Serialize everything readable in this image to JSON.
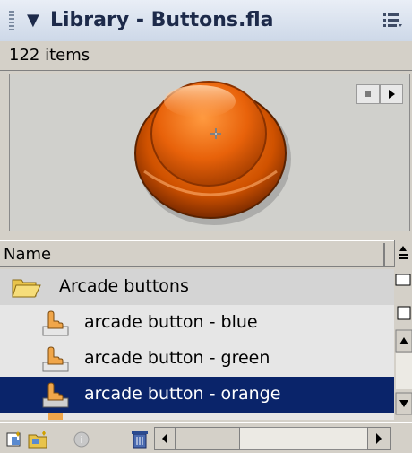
{
  "panel": {
    "title": "Library - Buttons.fla",
    "item_count": "122 items"
  },
  "preview": {
    "symbol": "arcade button - orange",
    "colors": {
      "face": "#e8620a",
      "rim": "#b84400",
      "highlight": "#ffb070"
    }
  },
  "list": {
    "column_header": "Name",
    "items": [
      {
        "label": "Arcade buttons",
        "icon": "folder-open-icon"
      },
      {
        "label": "arcade button - blue",
        "icon": "button-symbol-icon"
      },
      {
        "label": "arcade button - green",
        "icon": "button-symbol-icon"
      },
      {
        "label": "arcade button - orange",
        "icon": "button-symbol-icon",
        "selected": true
      }
    ]
  },
  "toolbar": {
    "icons": [
      "new-symbol-icon",
      "new-folder-icon",
      "properties-icon",
      "delete-icon"
    ]
  },
  "colors": {
    "selection": "#0a246a",
    "panel": "#d4d0c8"
  }
}
